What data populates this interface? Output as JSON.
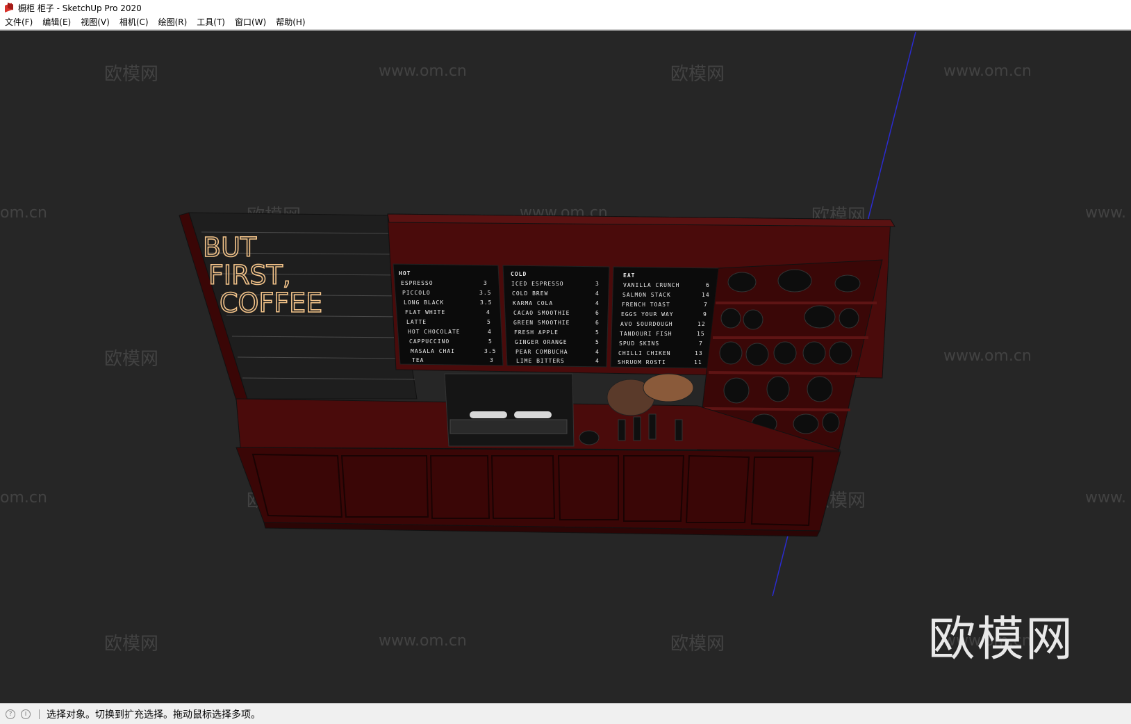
{
  "window": {
    "title": "橱柜 柜子 - SketchUp Pro 2020"
  },
  "menu": [
    {
      "label": "文件(F)"
    },
    {
      "label": "编辑(E)"
    },
    {
      "label": "视图(V)"
    },
    {
      "label": "相机(C)"
    },
    {
      "label": "绘图(R)"
    },
    {
      "label": "工具(T)"
    },
    {
      "label": "窗口(W)"
    },
    {
      "label": "帮助(H)"
    }
  ],
  "watermark": {
    "brand": "欧模网",
    "url": "www.om.cn",
    "url_partial": "om.cn",
    "url_prefix": "www."
  },
  "scene": {
    "neon_sign": [
      "BUT",
      "FIRST,",
      "COFFEE"
    ],
    "menu_boards": [
      {
        "heading": "HOT",
        "items": [
          {
            "name": "ESPRESSO",
            "price": "3"
          },
          {
            "name": "PICCOLO",
            "price": "3.5"
          },
          {
            "name": "LONG BLACK",
            "price": "3.5"
          },
          {
            "name": "FLAT WHITE",
            "price": "4"
          },
          {
            "name": "LATTE",
            "price": "5"
          },
          {
            "name": "HOT CHOCOLATE",
            "price": "4"
          },
          {
            "name": "CAPPUCCINO",
            "price": "5"
          },
          {
            "name": "MASALA CHAI",
            "price": "3.5"
          },
          {
            "name": "TEA",
            "price": "3"
          }
        ]
      },
      {
        "heading": "COLD",
        "items": [
          {
            "name": "ICED ESPRESSO",
            "price": "3"
          },
          {
            "name": "COLD BREW",
            "price": "4"
          },
          {
            "name": "KARMA COLA",
            "price": "4"
          },
          {
            "name": "CACAO SMOOTHIE",
            "price": "6"
          },
          {
            "name": "GREEN SMOOTHIE",
            "price": "6"
          },
          {
            "name": "FRESH APPLE",
            "price": "5"
          },
          {
            "name": "GINGER ORANGE",
            "price": "5"
          },
          {
            "name": "PEAR COMBUCHA",
            "price": "4"
          },
          {
            "name": "LIME BITTERS",
            "price": "4"
          }
        ]
      },
      {
        "heading": "EAT",
        "items": [
          {
            "name": "VANILLA CRUNCH",
            "price": "6"
          },
          {
            "name": "SALMON STACK",
            "price": "14"
          },
          {
            "name": "FRENCH TOAST",
            "price": "7"
          },
          {
            "name": "EGGS YOUR WAY",
            "price": "9"
          },
          {
            "name": "AVO SOURDOUGH",
            "price": "12"
          },
          {
            "name": "TANDOURI FISH",
            "price": "15"
          },
          {
            "name": "SPUD SKINS",
            "price": "7"
          },
          {
            "name": "CHILLI CHIKEN",
            "price": "13"
          },
          {
            "name": "SHRUOM ROSTI",
            "price": "11"
          }
        ]
      }
    ]
  },
  "status": {
    "text": "选择对象。切换到扩充选择。拖动鼠标选择多项。"
  },
  "colors": {
    "viewport_bg": "#262626",
    "cabinet": "#4a0b0b",
    "cabinet_dark": "#2b0505",
    "neon": "#f4c48a"
  }
}
